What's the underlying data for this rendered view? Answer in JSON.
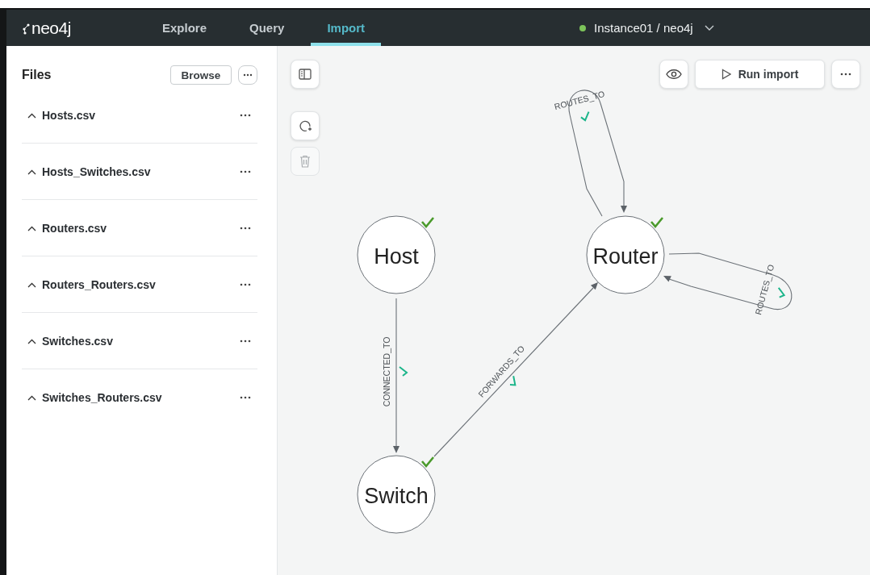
{
  "header": {
    "logo": "neo4j",
    "tabs": [
      {
        "label": "Explore",
        "selected": false
      },
      {
        "label": "Query",
        "selected": false
      },
      {
        "label": "Import",
        "selected": true
      }
    ],
    "instance": {
      "name": "Instance01 / neo4j",
      "connected": true
    }
  },
  "files_panel": {
    "title": "Files",
    "browse_button": "Browse",
    "files": [
      {
        "name": "Hosts.csv"
      },
      {
        "name": "Hosts_Switches.csv"
      },
      {
        "name": "Routers.csv"
      },
      {
        "name": "Routers_Routers.csv"
      },
      {
        "name": "Switches.csv"
      },
      {
        "name": "Switches_Routers.csv"
      }
    ]
  },
  "canvas_tools": [
    {
      "kind": "sidebar",
      "disabled": false
    },
    {
      "kind": "lasso",
      "disabled": false
    },
    {
      "kind": "delete",
      "disabled": true
    }
  ],
  "run_button": "Run import",
  "graph": {
    "nodes": [
      {
        "label": "Host",
        "mapped": true
      },
      {
        "label": "Router",
        "mapped": true
      },
      {
        "label": "Switch",
        "mapped": true
      }
    ],
    "relationships": [
      {
        "type": "CONNECTED_TO",
        "mapped": true
      },
      {
        "type": "FORWARDS_TO",
        "mapped": true
      },
      {
        "type": "ROUTES_TO",
        "mapped": true
      },
      {
        "type": "ROUTES_TO",
        "mapped": true
      }
    ]
  }
}
